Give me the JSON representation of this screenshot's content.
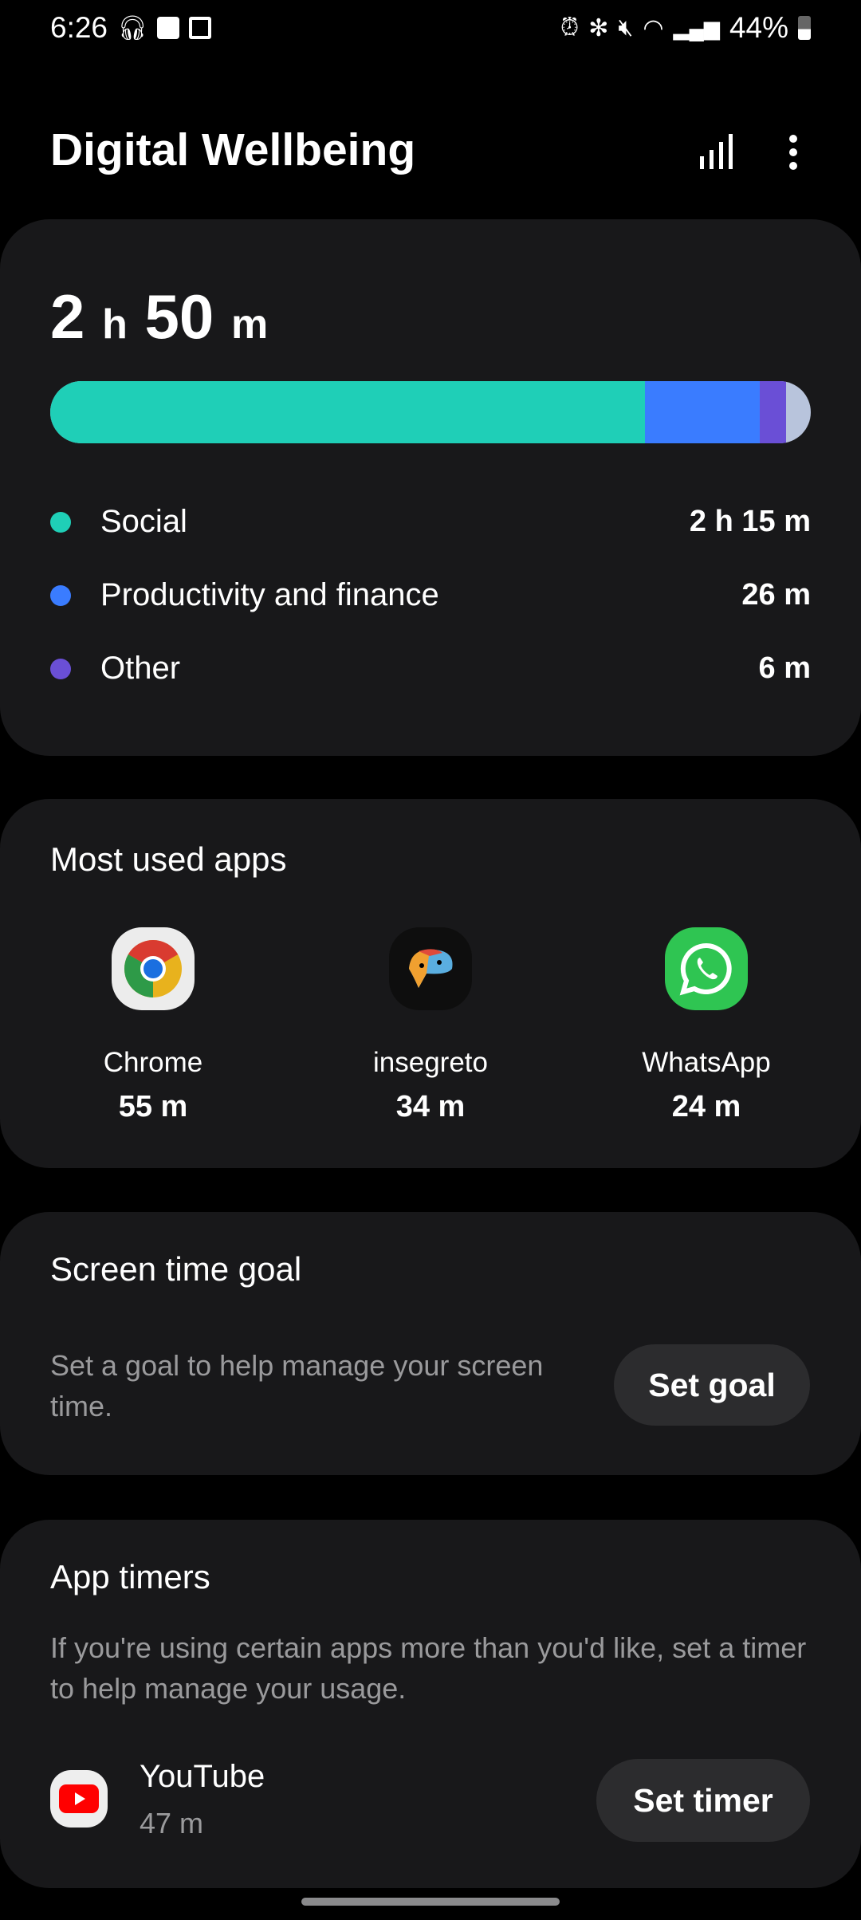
{
  "status_bar": {
    "time": "6:26",
    "battery": "44%",
    "left_icons": [
      "headphones-icon",
      "gallery-icon",
      "calendar-icon"
    ],
    "right_icons": [
      "alarm-icon",
      "bluetooth-icon",
      "mute-icon",
      "wifi-icon",
      "signal-icon",
      "battery-icon"
    ]
  },
  "header": {
    "title": "Digital Wellbeing"
  },
  "usage": {
    "hours": "2",
    "h_unit": "h",
    "minutes": "50",
    "m_unit": "m",
    "categories": [
      {
        "label": "Social",
        "value": "2 h 15 m",
        "minutes": 135,
        "color": "#1fcfb7"
      },
      {
        "label": "Productivity and finance",
        "value": "26 m",
        "minutes": 26,
        "color": "#3a7cff"
      },
      {
        "label": "Other",
        "value": "6 m",
        "minutes": 6,
        "color": "#6a4fd6"
      }
    ],
    "remainder_color": "#b8c4dc"
  },
  "most_used": {
    "title": "Most used apps",
    "apps": [
      {
        "name": "Chrome",
        "time": "55 m"
      },
      {
        "name": "insegreto",
        "time": "34 m"
      },
      {
        "name": "WhatsApp",
        "time": "24 m"
      }
    ]
  },
  "goal": {
    "title": "Screen time goal",
    "desc": "Set a goal to help manage your screen time.",
    "button": "Set goal"
  },
  "timers": {
    "title": "App timers",
    "desc": "If you're using certain apps more than you'd like, set a timer to help manage your usage.",
    "app": {
      "name": "YouTube",
      "time": "47 m"
    },
    "button": "Set timer"
  }
}
